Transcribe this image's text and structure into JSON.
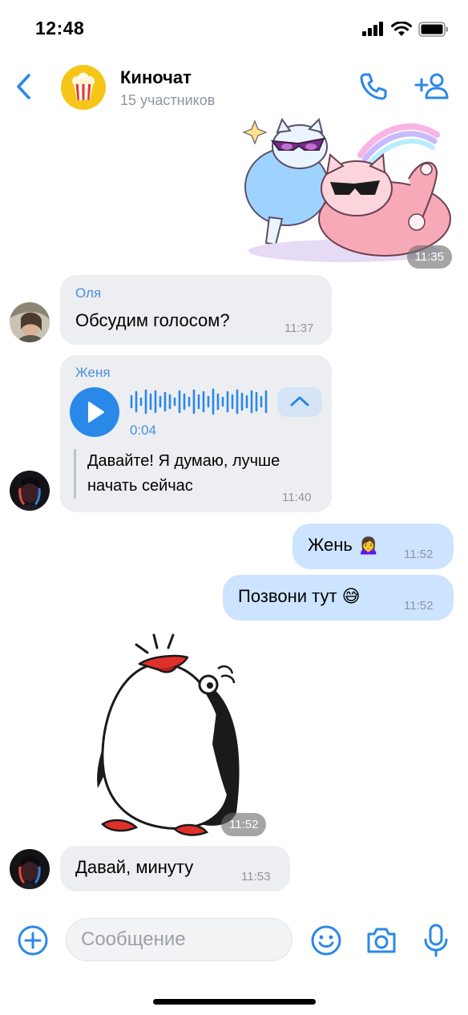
{
  "status_bar": {
    "time": "12:48"
  },
  "header": {
    "title": "Киночат",
    "subtitle": "15 участников"
  },
  "messages": [
    {
      "type": "sticker",
      "direction": "out",
      "sticker": "cats-sunglasses",
      "time": "11:35"
    },
    {
      "type": "text",
      "direction": "in",
      "sender": "Оля",
      "text": "Обсудим голосом?",
      "time": "11:37"
    },
    {
      "type": "voice",
      "direction": "in",
      "sender": "Женя",
      "duration": "0:04",
      "transcript_line1": "Давайте! Я думаю, лучше",
      "transcript_line2": "начать сейчас",
      "time": "11:40"
    },
    {
      "type": "text",
      "direction": "out",
      "text": "Жень 🙍‍♀️",
      "time": "11:52"
    },
    {
      "type": "text",
      "direction": "out",
      "text": "Позвони тут 😅",
      "time": "11:52"
    },
    {
      "type": "sticker",
      "direction": "in",
      "sticker": "penguin",
      "time": "11:52"
    },
    {
      "type": "text",
      "direction": "in",
      "text": "Давай, минуту",
      "time": "11:53"
    }
  ],
  "composer": {
    "placeholder": "Сообщение"
  },
  "colors": {
    "accent": "#2a88e8",
    "incoming_bubble": "#edeef1",
    "outgoing_bubble": "#cce4ff",
    "secondary_text": "#8e95a0"
  },
  "icons": [
    "back-chevron-icon",
    "popcorn-icon",
    "phone-icon",
    "add-user-icon",
    "play-icon",
    "chevron-up-icon",
    "plus-icon",
    "smile-icon",
    "camera-icon",
    "microphone-icon"
  ]
}
